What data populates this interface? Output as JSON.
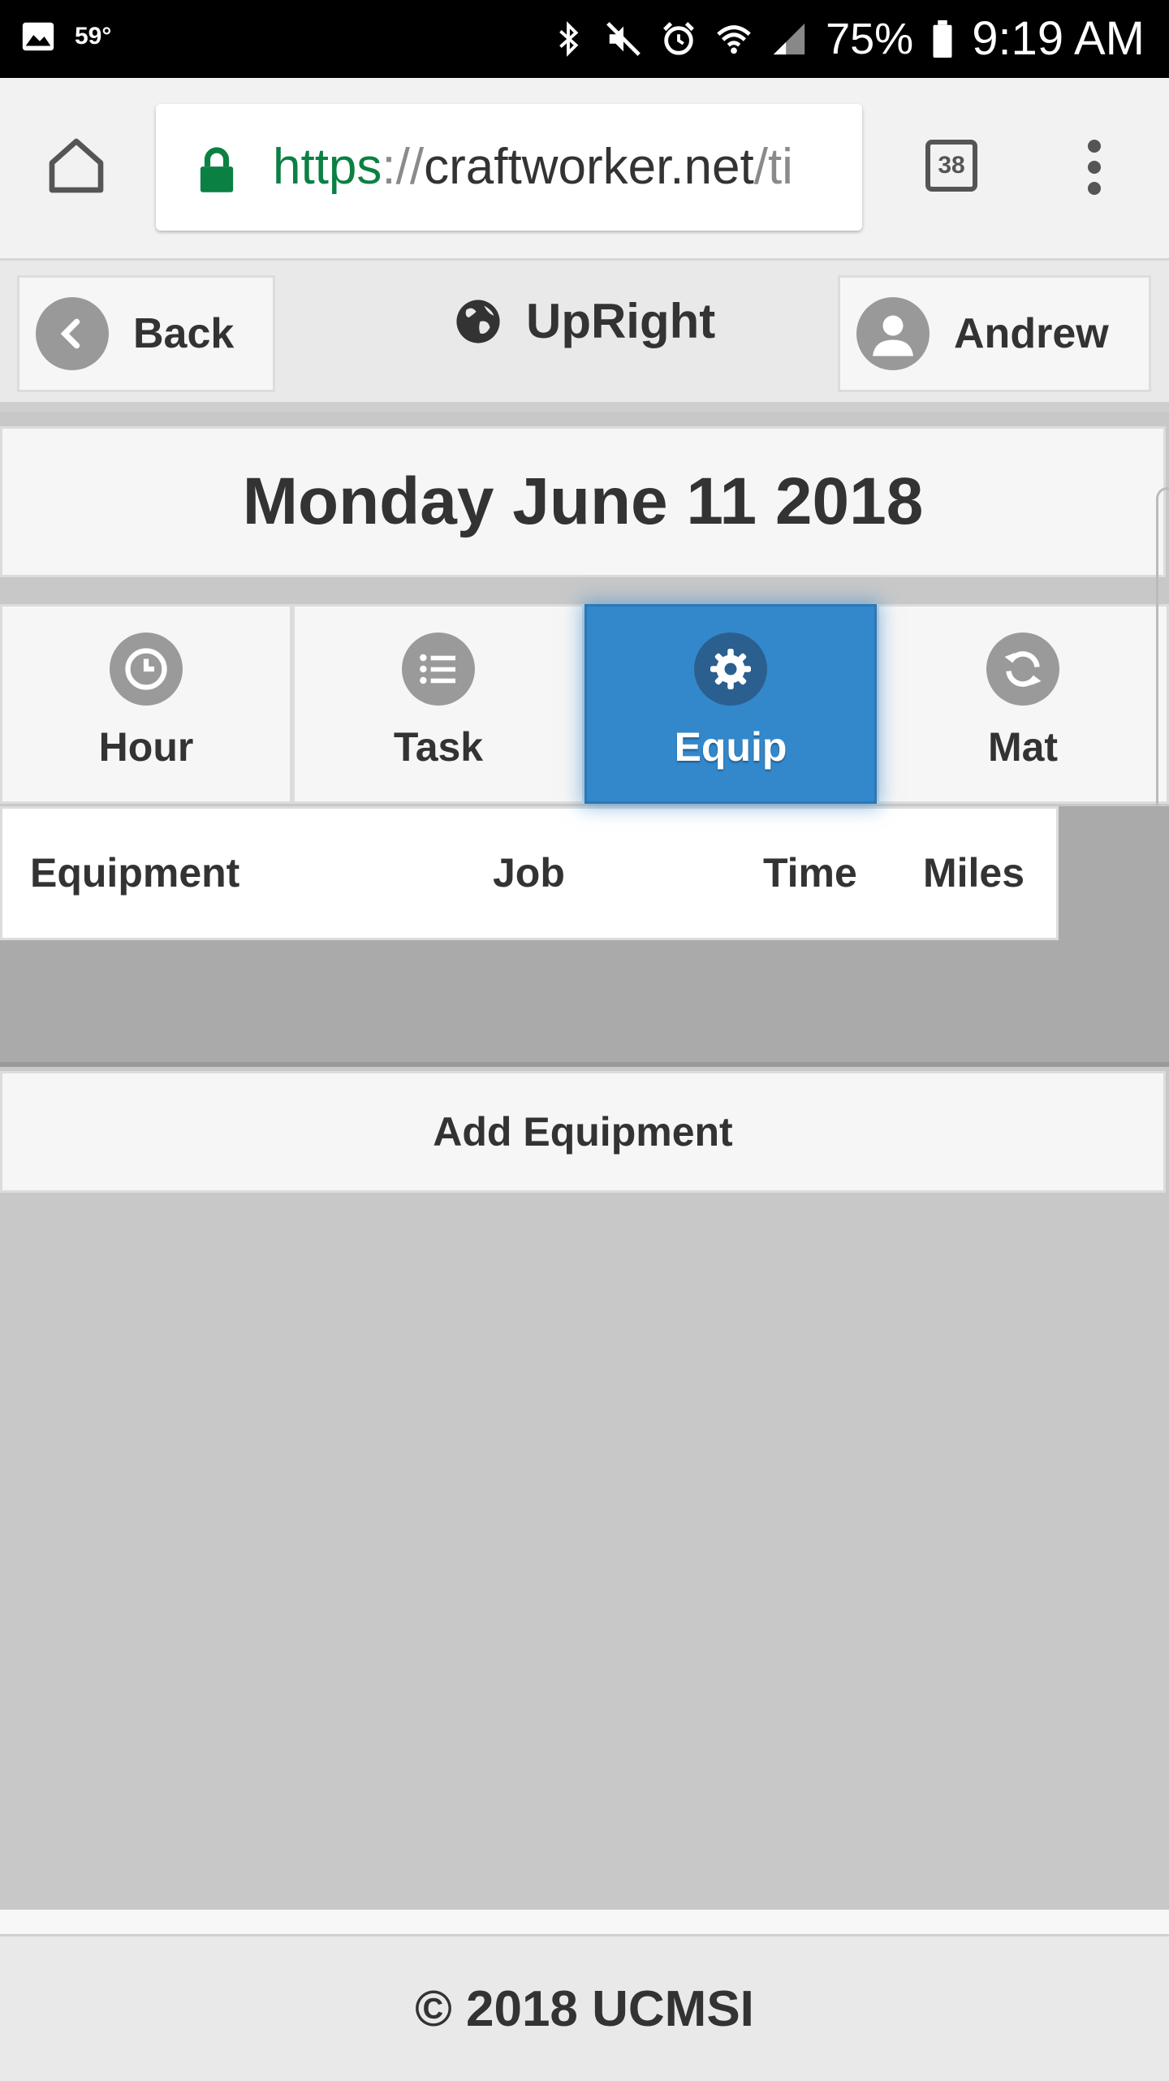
{
  "status_bar": {
    "temperature": "59°",
    "battery": "75%",
    "time": "9:19 AM"
  },
  "browser": {
    "url_scheme": "https",
    "url_sep": "://",
    "url_host": "craftworker.net",
    "url_path": "/ti",
    "tab_count": "38"
  },
  "header": {
    "back_label": "Back",
    "brand": "UpRight",
    "user_label": "Andrew"
  },
  "date_title": "Monday June 11 2018",
  "nav_tabs": [
    {
      "label": "Hour",
      "icon": "clock-icon"
    },
    {
      "label": "Task",
      "icon": "list-icon"
    },
    {
      "label": "Equip",
      "icon": "gear-icon",
      "active": true
    },
    {
      "label": "Mat",
      "icon": "refresh-icon"
    }
  ],
  "table": {
    "columns": [
      "Equipment",
      "Job",
      "Time",
      "Miles"
    ]
  },
  "add_button": "Add Equipment",
  "footer": "© 2018 UCMSI",
  "colors": {
    "active_tab": "#3388cc",
    "url_scheme": "#0b8043",
    "status_bar": "#000000"
  }
}
